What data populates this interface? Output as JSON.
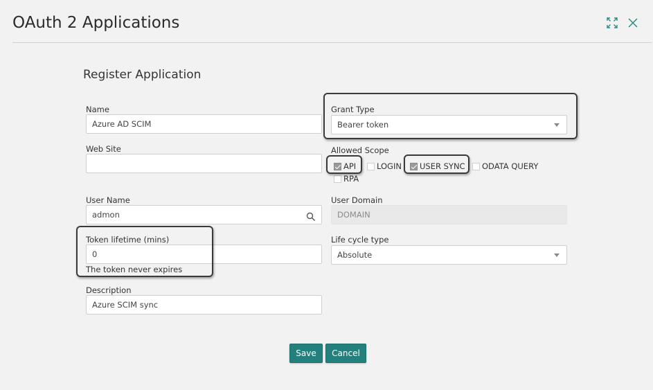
{
  "dialog": {
    "title": "OAuth 2 Applications",
    "maximize_icon": "expand-icon",
    "close_icon": "close-icon"
  },
  "form": {
    "section_title": "Register Application",
    "name": {
      "label": "Name",
      "value": "Azure AD SCIM"
    },
    "web_site": {
      "label": "Web Site",
      "value": ""
    },
    "user_name": {
      "label": "User Name",
      "value": "admon"
    },
    "token_lifetime": {
      "label": "Token lifetime (mins)",
      "value": "0",
      "hint": "The token never expires"
    },
    "description": {
      "label": "Description",
      "value": "Azure SCIM sync"
    },
    "grant_type": {
      "label": "Grant Type",
      "value": "Bearer token"
    },
    "allowed_scope": {
      "label": "Allowed Scope",
      "options": [
        {
          "label": "API",
          "checked": true
        },
        {
          "label": "LOGIN",
          "checked": false
        },
        {
          "label": "USER SYNC",
          "checked": true
        },
        {
          "label": "ODATA QUERY",
          "checked": false
        },
        {
          "label": "RPA",
          "checked": false
        }
      ]
    },
    "user_domain": {
      "label": "User Domain",
      "value": "DOMAIN"
    },
    "life_cycle_type": {
      "label": "Life cycle type",
      "value": "Absolute"
    }
  },
  "buttons": {
    "save": "Save",
    "cancel": "Cancel"
  },
  "colors": {
    "primary_button": "#23807d",
    "highlight_border": "#3a3a3a",
    "background": "#f2f2f2"
  }
}
